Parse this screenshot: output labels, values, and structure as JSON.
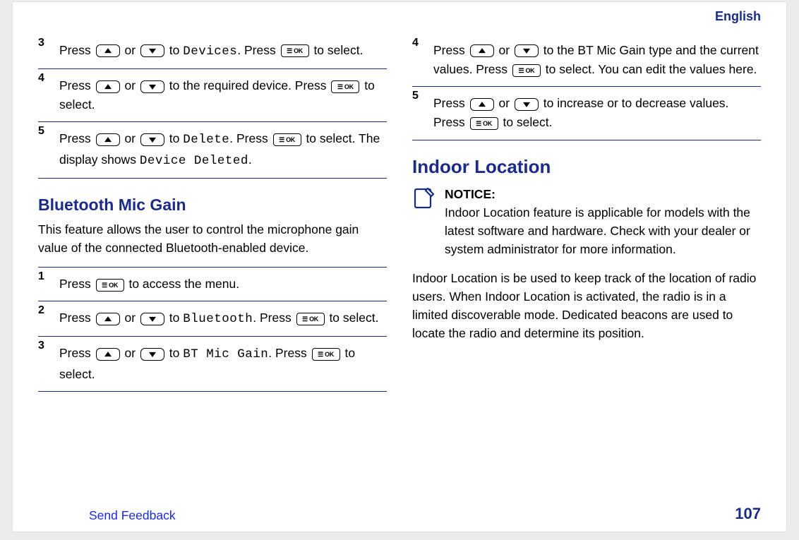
{
  "header": {
    "language": "English"
  },
  "footer": {
    "feedback": "Send Feedback",
    "page_number": "107"
  },
  "icons": {
    "ok_label": "☰ OK"
  },
  "left": {
    "steps_a": [
      {
        "num": "3",
        "t1": "Press ",
        "t2": " or ",
        "t3": " to ",
        "mono1": "Devices",
        "t4": ". Press ",
        "t5": " to select."
      },
      {
        "num": "4",
        "t1": "Press ",
        "t2": " or ",
        "t3": " to the required device. Press ",
        "t4": " to select."
      },
      {
        "num": "5",
        "t1": "Press ",
        "t2": " or ",
        "t3": " to ",
        "mono1": "Delete",
        "t4": ". Press ",
        "t5": " to select. The display shows ",
        "mono2": "Device Deleted",
        "t6": "."
      }
    ],
    "section_title": "Bluetooth Mic Gain",
    "section_intro": "This feature allows the user to control the microphone gain value of the connected Bluetooth-enabled device.",
    "steps_b": [
      {
        "num": "1",
        "t1": "Press ",
        "t2": " to access the menu."
      },
      {
        "num": "2",
        "t1": "Press ",
        "t2": " or ",
        "t3": " to ",
        "mono1": "Bluetooth",
        "t4": ". Press ",
        "t5": " to select."
      },
      {
        "num": "3",
        "t1": "Press ",
        "t2": " or ",
        "t3": " to ",
        "mono1": "BT Mic Gain",
        "t4": ". Press ",
        "t5": " to select."
      }
    ]
  },
  "right": {
    "steps": [
      {
        "num": "4",
        "t1": "Press ",
        "t2": " or ",
        "t3": " to the BT Mic Gain type and the current values. Press ",
        "t4": " to select. You can edit the values here."
      },
      {
        "num": "5",
        "t1": "Press ",
        "t2": " or ",
        "t3": " to increase or to decrease values. Press ",
        "t4": " to select."
      }
    ],
    "section_title": "Indoor Location",
    "notice": {
      "label": "NOTICE:",
      "text": "Indoor Location feature is applicable for models with the latest software and hardware. Check with your dealer or system administrator for more information."
    },
    "para": "Indoor Location is be used to keep track of the location of radio users. When Indoor Location is activated, the radio is in a limited discoverable mode. Dedicated beacons are used to locate the radio and determine its position."
  }
}
